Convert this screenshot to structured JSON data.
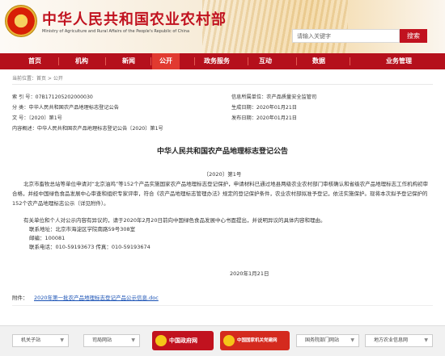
{
  "header": {
    "site_title": "中华人民共和国农业农村部",
    "site_subtitle": "Ministry of Agriculture and Rural Affairs of the People's Republic of China",
    "emblem_glyph": "★",
    "search_placeholder": "请输入关键字",
    "search_button": "搜索"
  },
  "nav": {
    "items": [
      "首页",
      "机构",
      "新闻",
      "公开",
      "政务服务",
      "互动",
      "数据",
      "业务管理"
    ],
    "active": "公开",
    "active_color": "#e13a30",
    "bar_color": "#b5101c"
  },
  "breadcrumb": "当前位置：首页 > 公开",
  "meta": {
    "index_no": "索 引 号：07B171205202000030",
    "category": "分    类：中华人民共和国农产品地理标志登记公告",
    "doc_no": "文    号：〔2020〕第1号",
    "summary": "内容概述：中华人民共和国农产品地理标志登记公告〔2020〕第1号",
    "issuer": "信息所属单位：农产品质量安全监管司",
    "effective_date": "生成日期：2020年01月21日",
    "publish_date": "发布日期：2020年01月21日"
  },
  "document": {
    "title": "中华人民共和国农产品地理标志登记公告",
    "number": "〔2020〕第1号",
    "para1": "北京市畜牧总站等单位申请对“北京油鸡”等152个产品实施国家农产品地理标志登记保护，申请材料已通过地县两级农业农村部门审核确认和省级农产品地理标志工作机构初审合格，并经中国绿色食品发展中心审查和组织专家评审，符合《农产品地理标志管理办法》规定的登记保护条件，农业农村部拟准予登记，依法实施保护。现将本次拟予登记保护的152个农产品地理标志公示（详见附件）。",
    "para2": "有关单位和个人对公示内容有异议的，请于2020年2月20日前向中国绿色食品发展中心书面提出，并说明异议的具体内容和理由。",
    "contact_unit": "联系地址：北京市海淀区学院南路59号308室",
    "postcode": "邮编：100081",
    "phone": "联系电话：010-59193673    传真：010-59193674",
    "date": "2020年1月21日",
    "attachment_label": "附件：",
    "attachment_link": "2020年第一批农产品地理标志登记产品公示信息.doc"
  },
  "footer": {
    "select1": "机关子站",
    "select2": "司局网站",
    "logo1": "中国政府网",
    "logo2": "中国国家机关党建网",
    "select3": "国务院部门网站",
    "select4": "地方农业信息网",
    "caret": "▼"
  }
}
